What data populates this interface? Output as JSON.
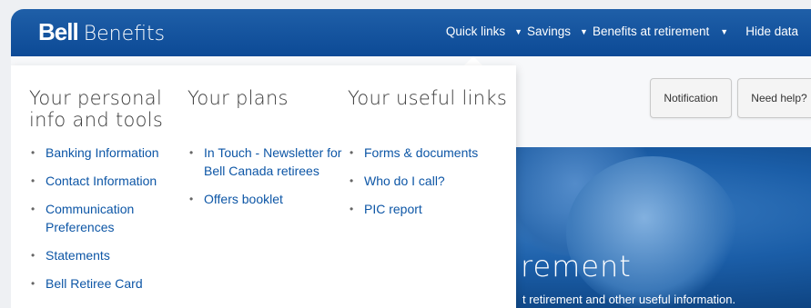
{
  "brand": {
    "bell": "Bell",
    "benefits": "Benefits"
  },
  "nav": {
    "quick_links": "Quick links",
    "savings": "Savings",
    "benefits_at_retirement": "Benefits at retirement",
    "hide_data": "Hide data"
  },
  "buttons": {
    "notification": "Notification",
    "need_help": "Need help?"
  },
  "panel": {
    "col1": {
      "title_line1": "Your personal",
      "title_line2": "info and tools",
      "items": [
        "Banking Information",
        "Contact Information",
        "Communication Preferences",
        "Statements",
        "Bell Retiree Card"
      ]
    },
    "col2": {
      "title": "Your plans",
      "items": [
        "In Touch - Newsletter for Bell Canada retirees",
        "Offers booklet"
      ]
    },
    "col3": {
      "title": "Your useful links",
      "items": [
        "Forms & documents",
        "Who do I call?",
        "PIC report"
      ]
    }
  },
  "hero": {
    "title": "rement",
    "subtitle": "t retirement and other useful information."
  },
  "colors": {
    "header_blue": "#0c4a96",
    "link_blue": "#0d56a6"
  }
}
